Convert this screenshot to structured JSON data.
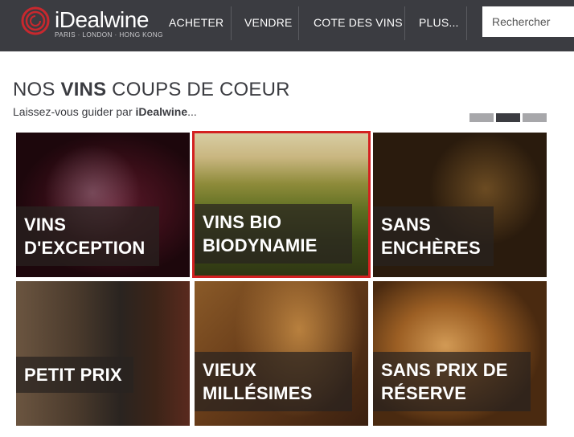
{
  "header": {
    "logo": {
      "prefix": "i",
      "name": "Dealwine",
      "tagline": "PARIS · LONDON · HONG KONG"
    },
    "nav": [
      {
        "label": "ACHETER"
      },
      {
        "label": "VENDRE"
      },
      {
        "label": "COTE DES VINS"
      },
      {
        "label": "PLUS..."
      }
    ],
    "search": {
      "placeholder": "Rechercher",
      "value": ""
    }
  },
  "section": {
    "title_part1": "NOS ",
    "title_bold": "VINS",
    "title_part2": " COUPS DE COEUR",
    "subtitle_prefix": "Laissez-vous guider par ",
    "subtitle_bold": "iDealwine",
    "subtitle_suffix": "..."
  },
  "pager": {
    "count": 3,
    "active_index": 1
  },
  "tiles": [
    {
      "line1": "VINS",
      "line2": "D'EXCEPTION"
    },
    {
      "line1": "VINS BIO",
      "line2": "BIODYNAMIE",
      "selected": true
    },
    {
      "line1": "SANS",
      "line2": "ENCHÈRES"
    },
    {
      "line1": "PETIT PRIX",
      "line2": ""
    },
    {
      "line1": "VIEUX",
      "line2": "MILLÉSIMES"
    },
    {
      "line1": "SANS PRIX DE",
      "line2": "RÉSERVE"
    }
  ],
  "colors": {
    "header_bg": "#3b3c41",
    "logo_red": "#c8282e",
    "selected_border": "#d42020",
    "text_dark": "#3b3c41"
  }
}
